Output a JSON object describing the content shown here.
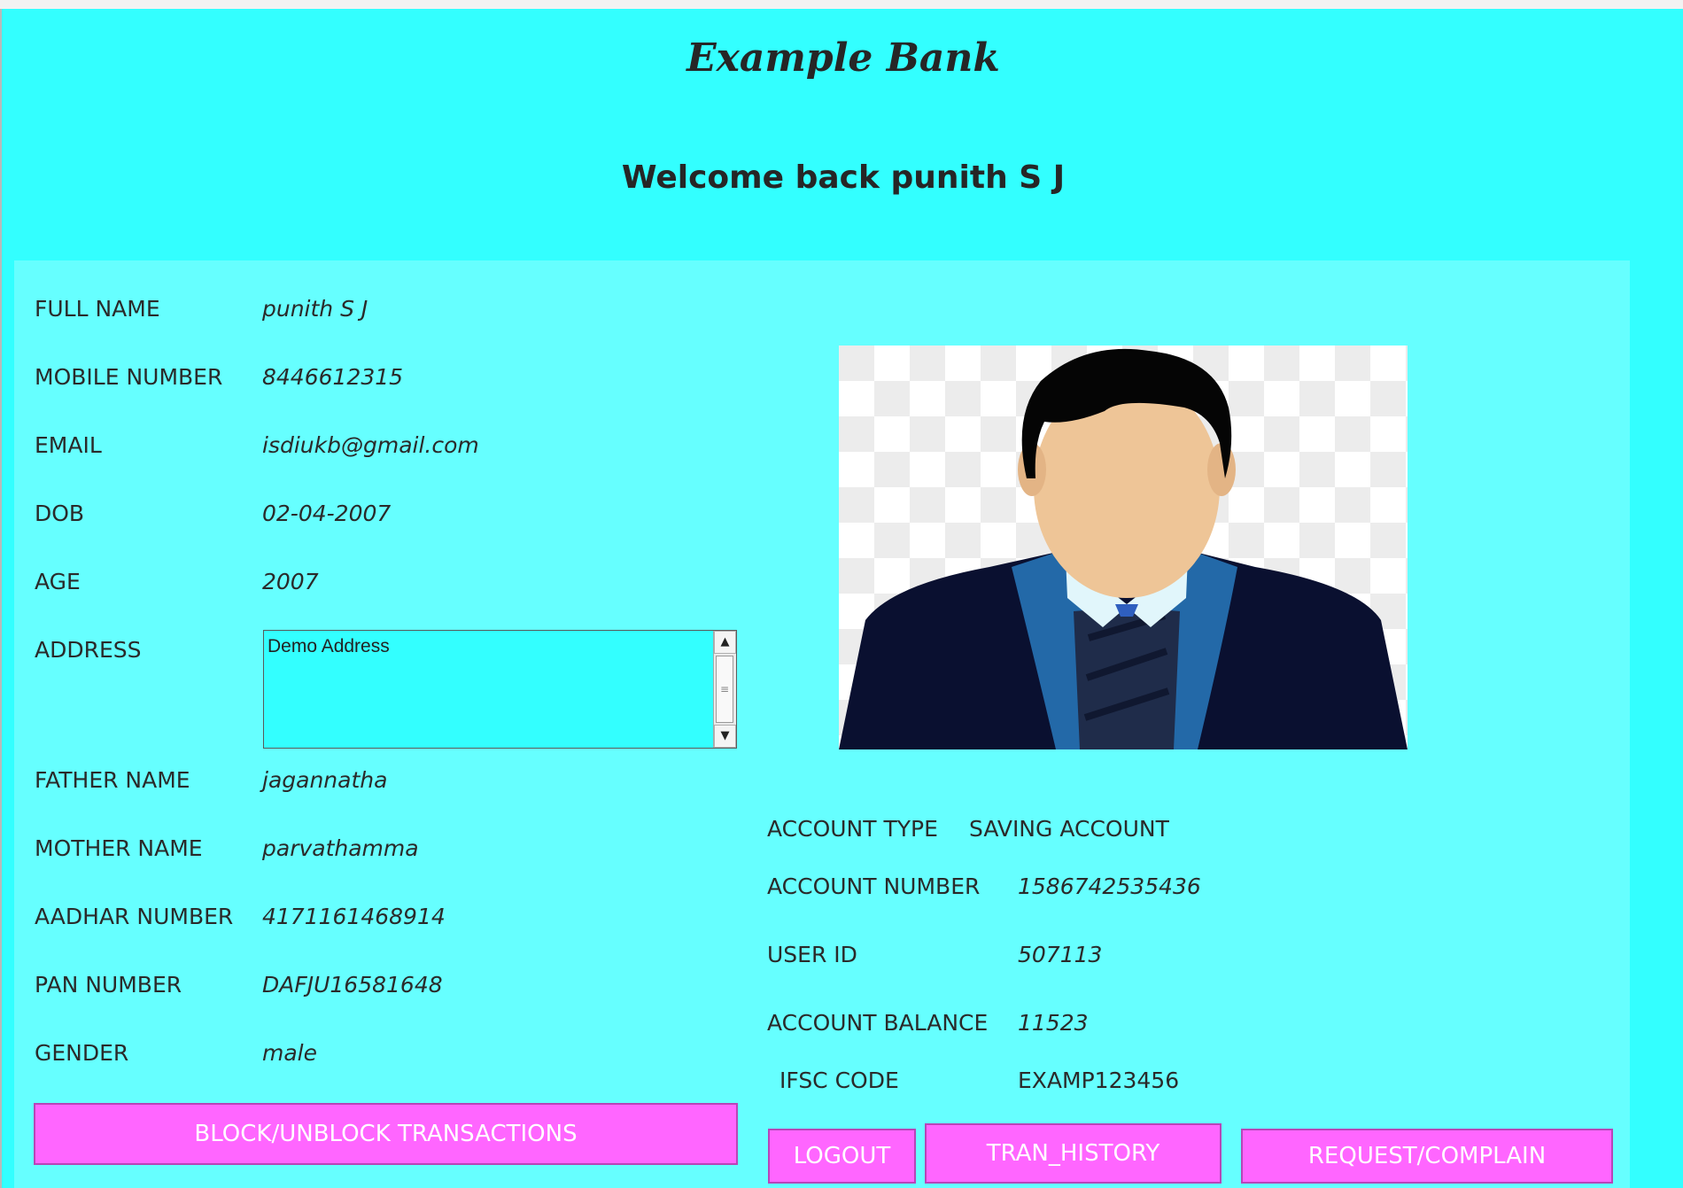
{
  "header": {
    "bank_name": "Example Bank",
    "welcome": "Welcome back punith S J"
  },
  "personal": {
    "full_name_label": "FULL NAME",
    "full_name": "punith S J",
    "mobile_label": "MOBILE NUMBER",
    "mobile": "8446612315",
    "email_label": "EMAIL",
    "email": "isdiukb@gmail.com",
    "dob_label": "DOB",
    "dob": "02-04-2007",
    "age_label": "AGE",
    "age": "2007",
    "address_label": "ADDRESS",
    "address": "Demo Address",
    "father_label": "FATHER NAME",
    "father": "jagannatha",
    "mother_label": "MOTHER NAME",
    "mother": "parvathamma",
    "aadhar_label": "AADHAR NUMBER",
    "aadhar": "4171161468914",
    "pan_label": "PAN NUMBER",
    "pan": "DAFJU16581648",
    "gender_label": "GENDER",
    "gender": "male"
  },
  "account": {
    "type_label": "ACCOUNT TYPE",
    "type": "SAVING ACCOUNT",
    "number_label": "ACCOUNT NUMBER",
    "number": "1586742535436",
    "user_id_label": "USER ID",
    "user_id": "507113",
    "balance_label": "ACCOUNT BALANCE",
    "balance": "11523",
    "ifsc_label": "IFSC CODE",
    "ifsc": "EXAMP123456"
  },
  "buttons": {
    "block": "BLOCK/UNBLOCK TRANSACTIONS",
    "logout": "LOGOUT",
    "history": "TRAN_HISTORY",
    "request": "REQUEST/COMPLAIN"
  },
  "colors": {
    "background": "#33ffff",
    "panel": "#66ffff",
    "button": "#ff66ff"
  },
  "icons": {
    "avatar": "user-avatar-icon",
    "scroll_up": "arrow-up-icon",
    "scroll_down": "arrow-down-icon"
  }
}
